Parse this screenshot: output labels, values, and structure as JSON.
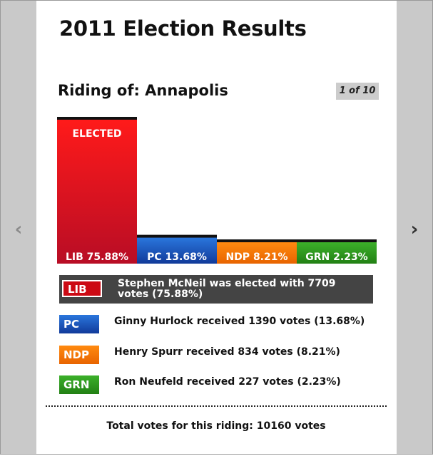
{
  "title": "2011 Election Results",
  "riding_label": "Riding of: Annapolis",
  "pager": "1 of 10",
  "nav": {
    "prev_icon": "chevron-left-icon",
    "next_icon": "chevron-right-icon",
    "prev_glyph": "‹",
    "next_glyph": "›"
  },
  "colors": {
    "LIB": "#cc0a14",
    "PC": "#1750c4",
    "NDP": "#f07800",
    "GRN": "#2e9a1e"
  },
  "chart_data": {
    "type": "bar",
    "categories": [
      "LIB",
      "PC",
      "NDP",
      "GRN"
    ],
    "values": [
      75.88,
      13.68,
      8.21,
      2.23
    ],
    "bar_labels": [
      "LIB 75.88%",
      "PC 13.68%",
      "NDP 8.21%",
      "GRN 2.23%"
    ],
    "annotation": "ELECTED",
    "ylim": [
      0,
      75.88
    ]
  },
  "legend": [
    {
      "party": "LIB",
      "text": "Stephen McNeil was elected with 7709 votes (75.88%)",
      "elected": true
    },
    {
      "party": "PC",
      "text": "Ginny Hurlock received 1390 votes (13.68%)",
      "elected": false
    },
    {
      "party": "NDP",
      "text": "Henry Spurr received 834 votes (8.21%)",
      "elected": false
    },
    {
      "party": "GRN",
      "text": "Ron Neufeld received 227 votes (2.23%)",
      "elected": false
    }
  ],
  "total": "Total votes for this riding: 10160 votes"
}
